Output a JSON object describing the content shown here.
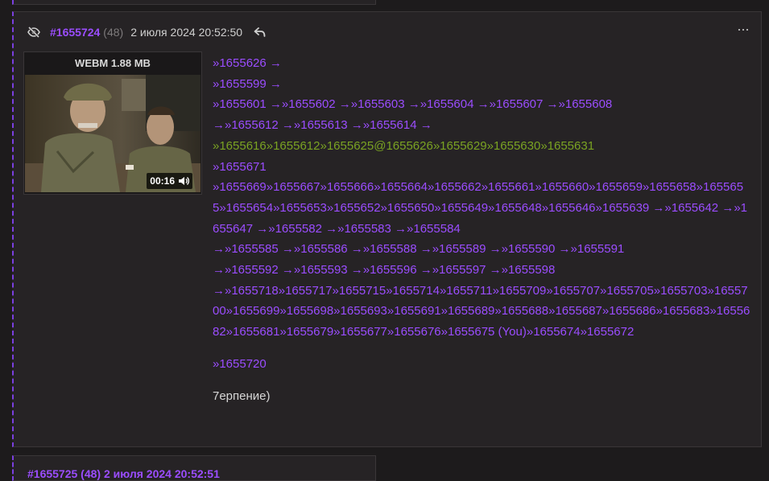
{
  "post": {
    "number": "#1655724",
    "reply_count": "(48)",
    "date": "2 июля 2024 20:52:50",
    "media": {
      "label": "WEBM 1.88 MB",
      "duration": "00:16"
    },
    "lines": [
      "»1655626 →",
      "»1655599 →",
      "»1655601 →»1655602 →»1655603 →»1655604 →»1655607 →»1655608",
      "→»1655612 →»1655613 →»1655614 →",
      "»1655616»1655612»1655625@1655626»1655629»1655630»1655631",
      "»1655671",
      "»1655669»1655667»1655666»1655664»1655662»1655661»1655660»1655659»1655658»1655655»1655654»1655653»1655652»1655650»1655649»1655648»1655646»1655639 →»1655642 →»1655647 →»1655582 →»1655583 →»1655584",
      "→»1655585 →»1655586 →»1655588 →»1655589 →»1655590 →»1655591",
      "→»1655592 →»1655593 →»1655596 →»1655597 →»1655598",
      "→»1655718»1655717»1655715»1655714»1655711»1655709»1655707»1655705»1655703»1655700»1655699»1655698»1655693»1655691»1655689»1655688»1655687»1655686»1655683»1655682»1655681»1655679»1655677»1655676»1655675 (You)»1655674»1655672"
    ],
    "reply_link": "»1655720",
    "text": "7ерпение)"
  },
  "next_post": {
    "peek": "#1655725 (48) 2 июля 2024 20:52:51"
  },
  "colors": {
    "accent": "#9b4dff",
    "greentext": "#7aa322",
    "background": "#1d1b1c",
    "post_bg": "#262325"
  },
  "icons": {
    "hide": "eye-slash-icon",
    "reply": "reply-arrow-icon",
    "menu": "more-dots-icon",
    "volume": "volume-icon"
  }
}
